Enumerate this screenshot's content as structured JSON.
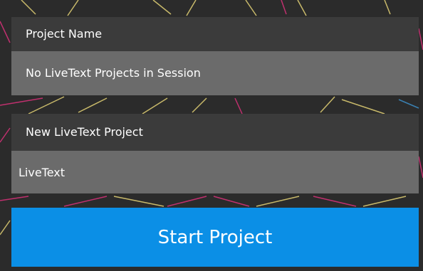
{
  "project_name": {
    "header": "Project Name",
    "value": "No LiveText Projects in Session"
  },
  "new_project": {
    "header": "New LiveText Project",
    "input_value": "LiveText"
  },
  "start_button_label": "Start Project",
  "colors": {
    "background": "#2b2b2b",
    "header_bg": "#3b3b3b",
    "value_bg": "#6b6b6b",
    "accent": "#0b8fe6",
    "line_yellow": "#c8b96a",
    "line_pink": "#c0306e",
    "line_blue": "#3a7fb0"
  }
}
